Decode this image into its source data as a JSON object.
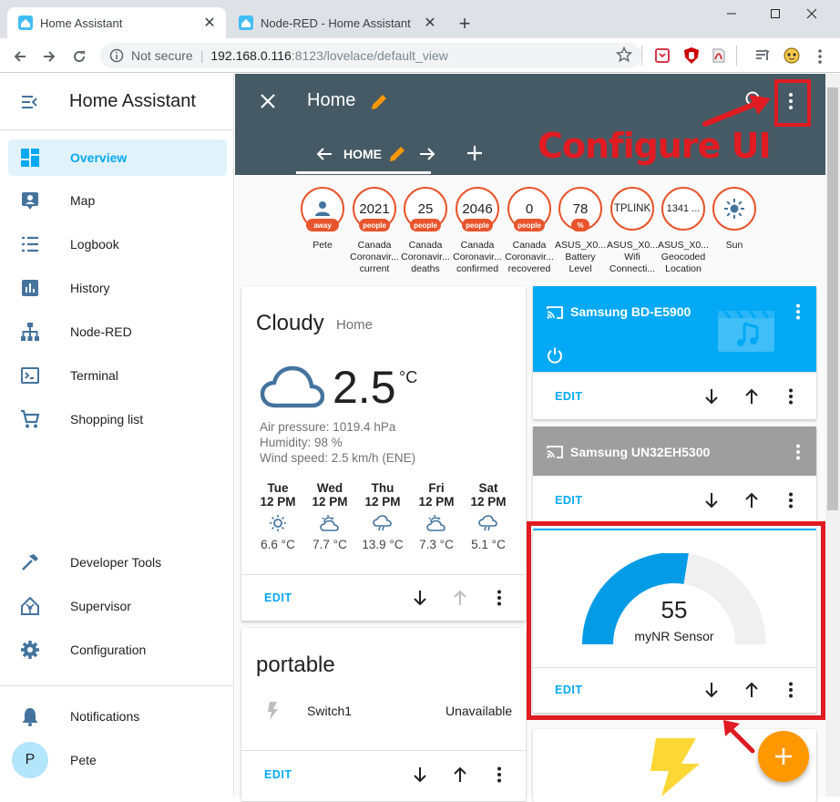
{
  "browser": {
    "tabs": [
      {
        "title": "Home Assistant"
      },
      {
        "title": "Node-RED - Home Assistant"
      }
    ],
    "address": {
      "security": "Not secure",
      "host": "192.168.0.116",
      "port_path": ":8123/lovelace/default_view"
    }
  },
  "sidebar": {
    "title": "Home Assistant",
    "items": [
      {
        "label": "Overview",
        "icon": "overview-icon"
      },
      {
        "label": "Map",
        "icon": "map-icon"
      },
      {
        "label": "Logbook",
        "icon": "logbook-icon"
      },
      {
        "label": "History",
        "icon": "history-icon"
      },
      {
        "label": "Node-RED",
        "icon": "node-red-icon"
      },
      {
        "label": "Terminal",
        "icon": "terminal-icon"
      },
      {
        "label": "Shopping list",
        "icon": "cart-icon"
      }
    ],
    "bottom_items": [
      {
        "label": "Developer Tools",
        "icon": "hammer-icon"
      },
      {
        "label": "Supervisor",
        "icon": "supervisor-icon"
      },
      {
        "label": "Configuration",
        "icon": "gear-icon"
      }
    ],
    "notifications": "Notifications",
    "user": {
      "initial": "P",
      "name": "Pete"
    }
  },
  "header": {
    "title": "Home",
    "view_tab": "HOME",
    "annotation": "Configure UI"
  },
  "badges": [
    {
      "value": "",
      "label": "AWAY",
      "name": "Pete"
    },
    {
      "value": "2021",
      "label": "people",
      "name": "Canada\nCoronavir...\ncurrent"
    },
    {
      "value": "25",
      "label": "people",
      "name": "Canada\nCoronavir...\ndeaths"
    },
    {
      "value": "2046",
      "label": "people",
      "name": "Canada\nCoronavir...\nconfirmed"
    },
    {
      "value": "0",
      "label": "people",
      "name": "Canada\nCoronavir...\nrecovered"
    },
    {
      "value": "78",
      "label": "%",
      "name": "ASUS_X0...\nBattery\nLevel"
    },
    {
      "value": "TPLINK",
      "label": "",
      "name": "ASUS_X0...\nWifi\nConnecti..."
    },
    {
      "value": "1341 ...",
      "label": "",
      "name": "ASUS_X0...\nGeocoded\nLocation"
    },
    {
      "value": "",
      "label": "",
      "name": "Sun"
    }
  ],
  "weather": {
    "condition": "Cloudy",
    "location": "Home",
    "temperature": "2.5",
    "unit": "°C",
    "pressure": "Air pressure: 1019.4 hPa",
    "humidity": "Humidity: 98 %",
    "wind": "Wind speed: 2.5 km/h (ENE)",
    "forecast": [
      {
        "day": "Tue",
        "time": "12 PM",
        "temp": "6.6 °C"
      },
      {
        "day": "Wed",
        "time": "12 PM",
        "temp": "7.7 °C"
      },
      {
        "day": "Thu",
        "time": "12 PM",
        "temp": "13.9 °C"
      },
      {
        "day": "Fri",
        "time": "12 PM",
        "temp": "7.3 °C"
      },
      {
        "day": "Sat",
        "time": "12 PM",
        "temp": "5.1 °C"
      }
    ]
  },
  "portable": {
    "title": "portable",
    "entity": "Switch1",
    "state": "Unavailable"
  },
  "media1": {
    "name": "Samsung BD-E5900"
  },
  "media2": {
    "name": "Samsung UN32EH5300"
  },
  "gauge": {
    "value": "55",
    "name": "myNR Sensor",
    "fraction": 0.55
  },
  "edit_label": "EDIT",
  "colors": {
    "header": "#455a64",
    "accent": "#03a9f4",
    "badge": "#e8542c",
    "fab": "#ff9800",
    "annotation": "#e01b22"
  }
}
